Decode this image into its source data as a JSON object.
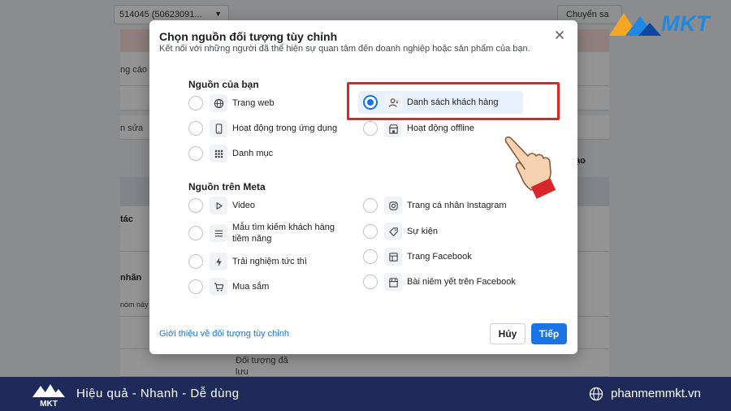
{
  "background": {
    "account_selector": "514045 (50623091...",
    "switch_button": "Chuyển sa",
    "fragments": [
      "ng cáo",
      "n sửa",
      "tác",
      "nhãn",
      "nóm này",
      "ạo",
      "Đối tượng đã",
      "lưu"
    ]
  },
  "logo": {
    "text": "MKT"
  },
  "modal": {
    "title": "Chọn nguồn đối tượng tùy chỉnh",
    "subtitle": "Kết nối với những người đã thể hiện sự quan tâm đến doanh nghiệp hoặc sản phẩm của bạn.",
    "section_your_sources": "Nguồn của bạn",
    "section_meta_sources": "Nguồn trên Meta",
    "your_sources": [
      {
        "label": "Trang web",
        "icon": "globe-icon",
        "selected": false
      },
      {
        "label": "Danh sách khách hàng",
        "icon": "person-icon",
        "selected": true
      },
      {
        "label": "Hoạt động trong ứng dụng",
        "icon": "phone-icon",
        "selected": false
      },
      {
        "label": "Hoạt động offline",
        "icon": "store-icon",
        "selected": false
      },
      {
        "label": "Danh mục",
        "icon": "grid-icon",
        "selected": false
      }
    ],
    "meta_sources": [
      {
        "label": "Video",
        "icon": "play-icon",
        "selected": false
      },
      {
        "label": "Trang cá nhân Instagram",
        "icon": "instagram-icon",
        "selected": false
      },
      {
        "label": "Mẫu tìm kiếm khách hàng tiềm năng",
        "icon": "list-icon",
        "selected": false
      },
      {
        "label": "Sự kiện",
        "icon": "tag-icon",
        "selected": false
      },
      {
        "label": "Trải nghiệm tức thì",
        "icon": "bolt-icon",
        "selected": false
      },
      {
        "label": "Trang Facebook",
        "icon": "flag-icon",
        "selected": false
      },
      {
        "label": "Mua sắm",
        "icon": "cart-icon",
        "selected": false
      },
      {
        "label": "Bài niêm yết trên Facebook",
        "icon": "shop-icon",
        "selected": false
      }
    ],
    "footer_link": "Giới thiệu về đối tượng tùy chỉnh",
    "cancel_label": "Hủy",
    "next_label": "Tiếp"
  },
  "banner": {
    "slogan": "Hiệu quả - Nhanh - Dễ dùng",
    "website": "phanmemmkt.vn",
    "logo_text": "MKT"
  },
  "colors": {
    "accent": "#1b74e4",
    "highlight": "#d9262b",
    "banner": "#1e2a5a"
  }
}
